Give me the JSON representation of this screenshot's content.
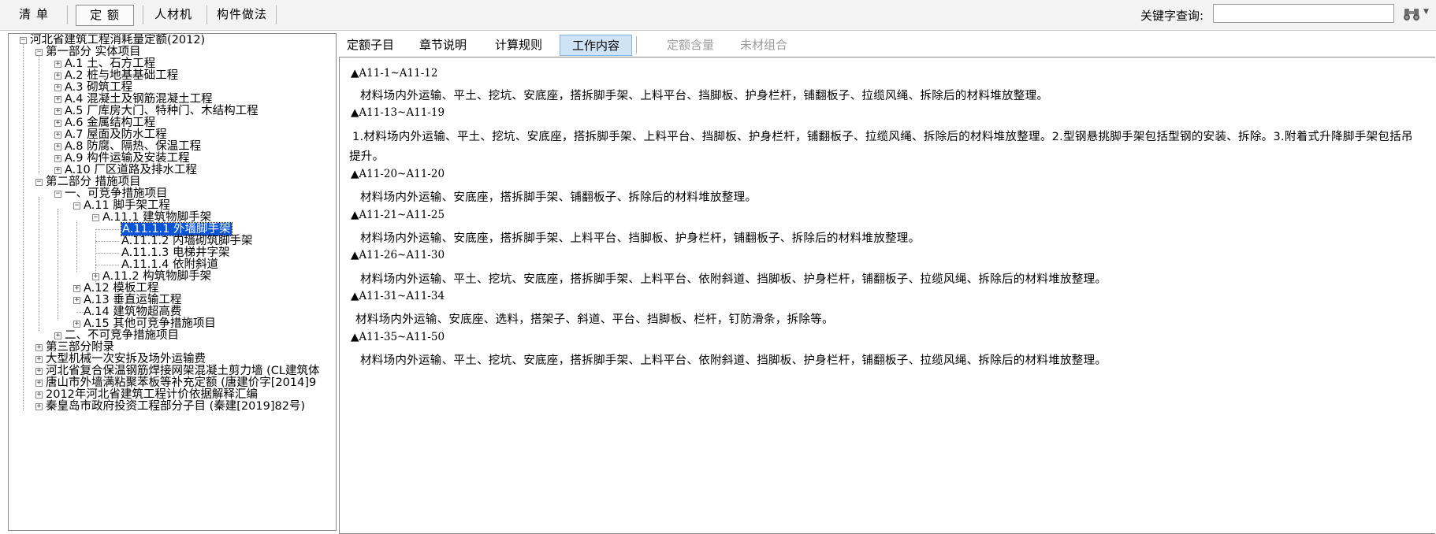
{
  "toolbar": {
    "tabs": [
      {
        "label": "清 单"
      },
      {
        "label": "定 额"
      },
      {
        "label": "人材机"
      },
      {
        "label": "构件做法"
      }
    ],
    "keyword_label": "关键字查询:",
    "keyword_value": ""
  },
  "tree": {
    "root": "河北省建筑工程消耗量定额(2012)",
    "nodes": [
      {
        "label": "第一部分 实体项目"
      },
      {
        "label": "A.1 土、石方工程"
      },
      {
        "label": "A.2 桩与地基基础工程"
      },
      {
        "label": "A.3 砌筑工程"
      },
      {
        "label": "A.4 混凝土及钢筋混凝土工程"
      },
      {
        "label": "A.5 厂库房大门、特种门、木结构工程"
      },
      {
        "label": "A.6 金属结构工程"
      },
      {
        "label": "A.7 屋面及防水工程"
      },
      {
        "label": "A.8 防腐、隔热、保温工程"
      },
      {
        "label": "A.9 构件运输及安装工程"
      },
      {
        "label": "A.10 厂区道路及排水工程"
      },
      {
        "label": "第二部分 措施项目"
      },
      {
        "label": "一、可竞争措施项目"
      },
      {
        "label": "A.11 脚手架工程"
      },
      {
        "label": "A.11.1 建筑物脚手架"
      },
      {
        "label": "A.11.1.1 外墙脚手架"
      },
      {
        "label": "A.11.1.2 内墙砌筑脚手架"
      },
      {
        "label": "A.11.1.3 电梯井字架"
      },
      {
        "label": "A.11.1.4 依附斜道"
      },
      {
        "label": "A.11.2 构筑物脚手架"
      },
      {
        "label": "A.12 模板工程"
      },
      {
        "label": "A.13 垂直运输工程"
      },
      {
        "label": "A.14 建筑物超高费"
      },
      {
        "label": "A.15 其他可竞争措施项目"
      },
      {
        "label": "二、不可竞争措施项目"
      },
      {
        "label": "第三部分附录"
      },
      {
        "label": "大型机械一次安拆及场外运输费"
      },
      {
        "label": "河北省复合保温钢筋焊接网架混凝土剪力墙 (CL建筑体"
      },
      {
        "label": "唐山市外墙满粘聚苯板等补充定额 (唐建价字[2014]9"
      },
      {
        "label": "2012年河北省建筑工程计价依据解释汇编"
      },
      {
        "label": "秦皇岛市政府投资工程部分子目 (秦建[2019]82号)"
      }
    ]
  },
  "tabs": [
    {
      "label": "定额子目"
    },
    {
      "label": "章节说明"
    },
    {
      "label": "计算规则"
    },
    {
      "label": "工作内容"
    },
    {
      "label": "定额含量"
    },
    {
      "label": "未材组合"
    }
  ],
  "content": {
    "sections": [
      {
        "code": "▲A11-1~A11-12",
        "lines": [
          "材料场内外运输、平土、挖坑、安底座，搭拆脚手架、上料平台、挡脚板、护身栏杆，铺翻板子、拉缆风绳、拆除后的材料堆放整理。"
        ]
      },
      {
        "code": "▲A11-13~A11-19",
        "lines": [
          "1.材料场内外运输、平土、挖坑、安底座，搭拆脚手架、上料平台、挡脚板、护身栏杆，铺翻板子、拉缆风绳、拆除后的材料堆放整理。2.型钢悬挑脚手架包括型钢的安装、拆除。3.附着式升降脚手架包括吊",
          "提升。"
        ]
      },
      {
        "code": "▲A11-20~A11-20",
        "lines": [
          "材料场内外运输、安底座，搭拆脚手架、铺翻板子、拆除后的材料堆放整理。"
        ]
      },
      {
        "code": "▲A11-21~A11-25",
        "lines": [
          "材料场内外运输、安底座，搭拆脚手架、上料平台、挡脚板、护身栏杆，铺翻板子、拆除后的材料堆放整理。"
        ]
      },
      {
        "code": "▲A11-26~A11-30",
        "lines": [
          "材料场内外运输、平土、挖坑、安底座，搭拆脚手架、上料平台、依附斜道、挡脚板、护身栏杆，铺翻板子、拉缆风绳、拆除后的材料堆放整理。"
        ]
      },
      {
        "code": "▲A11-31~A11-34",
        "lines": [
          "材料场内外运输、安底座、选料，搭架子、斜道、平台、挡脚板、栏杆，钉防滑条，拆除等。"
        ]
      },
      {
        "code": "▲A11-35~A11-50",
        "lines": [
          "材料场内外运输、平土、挖坑、安底座，搭拆脚手架、上料平台、依附斜道、挡脚板、护身栏杆，铺翻板子、拉缆风绳、拆除后的材料堆放整理。"
        ]
      }
    ]
  },
  "icons": {
    "search": "binoculars-icon",
    "dropdown": "chevron-down-icon"
  }
}
